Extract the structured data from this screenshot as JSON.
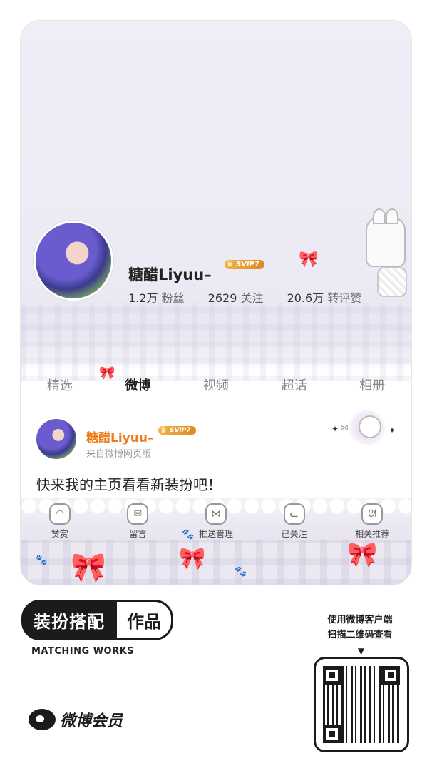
{
  "profile": {
    "username": "糖醋Liyuu–",
    "vip_badge": "SVIP7",
    "stats": [
      {
        "value": "1.2万",
        "label": "粉丝"
      },
      {
        "value": "2629",
        "label": "关注"
      },
      {
        "value": "20.6万",
        "label": "转评赞"
      }
    ]
  },
  "tabs": [
    {
      "label": "精选",
      "active": false
    },
    {
      "label": "微博",
      "active": true
    },
    {
      "label": "视频",
      "active": false
    },
    {
      "label": "超话",
      "active": false
    },
    {
      "label": "相册",
      "active": false
    }
  ],
  "post": {
    "username": "糖醋Liyuu–",
    "vip_badge": "SVIP7",
    "source": "来自微博网页版",
    "text": "快来我的主页看看新装扮吧！"
  },
  "actions": [
    {
      "label": "赞赏",
      "icon": "bag-icon"
    },
    {
      "label": "留言",
      "icon": "envelope-icon"
    },
    {
      "label": "推送管理",
      "icon": "bow-icon"
    },
    {
      "label": "已关注",
      "icon": "cat-icon"
    },
    {
      "label": "相关推荐",
      "icon": "bunny-icon"
    }
  ],
  "footer": {
    "badge_dark": "装扮搭配",
    "badge_light": "作品",
    "subtitle": "MATCHING WORKS",
    "brand": "微博会员",
    "qr_hint_line1": "使用微博客户端",
    "qr_hint_line2": "扫描二维码查看"
  },
  "colors": {
    "accent_orange": "#ef7a1a",
    "vip_gold": "#e9a13a",
    "background_lavender": "#eceaf4"
  }
}
